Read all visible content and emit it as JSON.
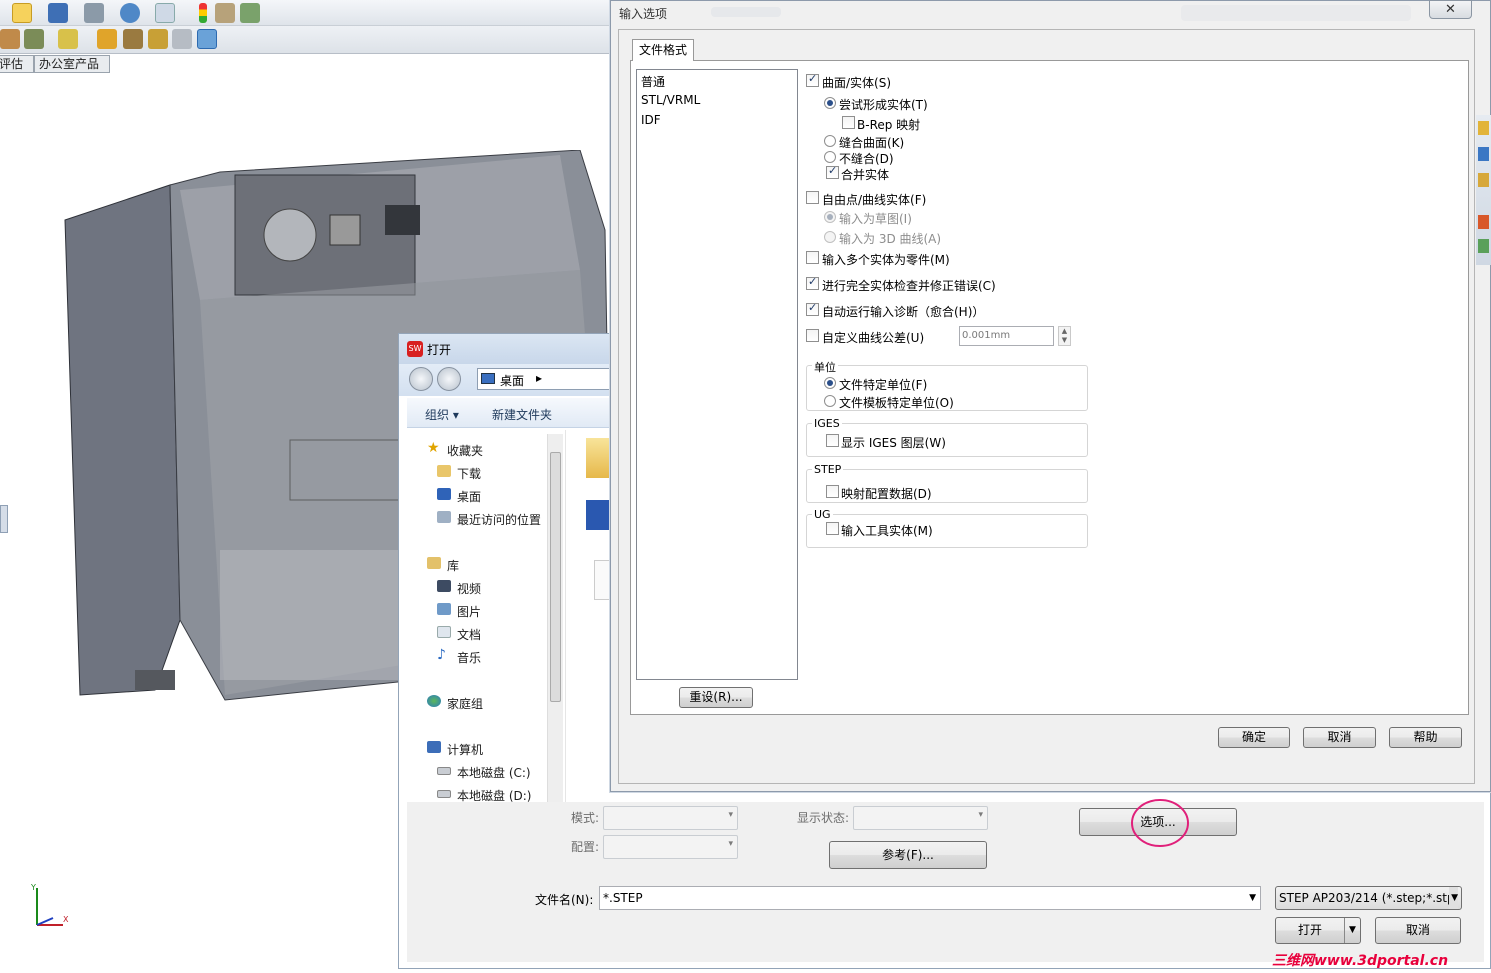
{
  "cad": {
    "command_tabs": [
      "评估",
      "办公室产品"
    ],
    "axis_labels": {
      "y": "Y",
      "x": "X"
    }
  },
  "open_dialog": {
    "title": "打开",
    "breadcrumb": "桌面",
    "organize_label": "组织 ▾",
    "new_folder_label": "新建文件夹",
    "tree": {
      "favorites": "收藏夹",
      "downloads": "下载",
      "desktop": "桌面",
      "recent": "最近访问的位置",
      "libraries": "库",
      "videos": "视频",
      "pictures": "图片",
      "documents": "文档",
      "music": "音乐",
      "homegroup": "家庭组",
      "computer": "计算机",
      "disk_c": "本地磁盘 (C:)",
      "disk_d": "本地磁盘 (D:)"
    },
    "mode_label": "模式:",
    "config_label": "配置:",
    "display_state_label": "显示状态:",
    "options_button": "选项...",
    "reference_button": "参考(F)...",
    "filename_label": "文件名(N):",
    "filename_value": "*.STEP",
    "filetype_value": "STEP AP203/214 (*.step;*.stp",
    "open_button": "打开",
    "cancel_button": "取消"
  },
  "options_dialog": {
    "title": "输入选项",
    "close_label": "✕",
    "tab": "文件格式",
    "formats": [
      "普通",
      "STL/VRML",
      "IDF"
    ],
    "reset_button": "重设(R)...",
    "surfaces_solids": "曲面/实体(S)",
    "try_form_solid": "尝试形成实体(T)",
    "brep_mapping": "B-Rep 映射",
    "knit_surfaces": "缝合曲面(K)",
    "do_not_knit": "不缝合(D)",
    "merge_entities": "合并实体",
    "free_point_curve": "自由点/曲线实体(F)",
    "import_as_sketch": "输入为草图(I)",
    "import_as_3d_curve": "输入为 3D 曲线(A)",
    "import_multiple_bodies": "输入多个实体为零件(M)",
    "full_check": "进行完全实体检查并修正错误(C)",
    "auto_diagnostics": "自动运行输入诊断（愈合(H)）",
    "custom_tolerance": "自定义曲线公差(U)",
    "tolerance_value": "0.001mm",
    "units_group": "单位",
    "file_units": "文件特定单位(F)",
    "template_units": "文件模板特定单位(O)",
    "iges_group": "IGES",
    "show_iges_levels": "显示 IGES 图层(W)",
    "step_group": "STEP",
    "map_config_data": "映射配置数据(D)",
    "ug_group": "UG",
    "import_tool_bodies": "输入工具实体(M)",
    "ok_button": "确定",
    "cancel_button": "取消",
    "help_button": "帮助"
  },
  "watermark": "三维网www.3dportal.cn",
  "colors": {
    "annotation_circle": "#e0207a",
    "watermark": "#e8003c"
  }
}
